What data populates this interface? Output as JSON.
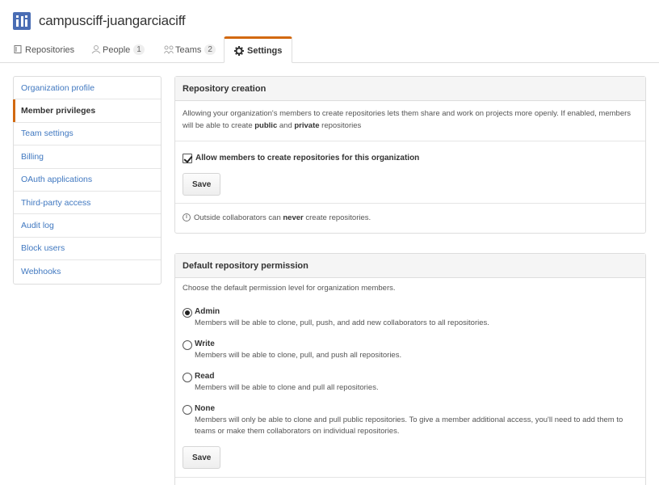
{
  "org": {
    "name": "campusciff-juangarciaciff"
  },
  "tabs": [
    {
      "label": "Repositories",
      "icon": "repo-icon"
    },
    {
      "label": "People",
      "count": "1",
      "icon": "people-icon"
    },
    {
      "label": "Teams",
      "count": "2",
      "icon": "teams-icon"
    },
    {
      "label": "Settings",
      "icon": "gear-icon"
    }
  ],
  "sidebar": {
    "items": [
      {
        "label": "Organization profile"
      },
      {
        "label": "Member privileges"
      },
      {
        "label": "Team settings"
      },
      {
        "label": "Billing"
      },
      {
        "label": "OAuth applications"
      },
      {
        "label": "Third-party access"
      },
      {
        "label": "Audit log"
      },
      {
        "label": "Block users"
      },
      {
        "label": "Webhooks"
      }
    ]
  },
  "repo_creation": {
    "title": "Repository creation",
    "desc_part1": "Allowing your organization's members to create repositories lets them share and work on projects more openly. If enabled, members will be able to create ",
    "desc_public": "public",
    "desc_and": " and ",
    "desc_private": "private",
    "desc_end": " repositories",
    "checkbox_label": "Allow members to create repositories for this organization",
    "save_label": "Save",
    "note_prefix": "Outside collaborators can ",
    "note_bold": "never",
    "note_suffix": " create repositories."
  },
  "default_permission": {
    "title": "Default repository permission",
    "intro": "Choose the default permission level for organization members.",
    "options": [
      {
        "label": "Admin",
        "desc": "Members will be able to clone, pull, push, and add new collaborators to all repositories."
      },
      {
        "label": "Write",
        "desc": "Members will be able to clone, pull, and push all repositories."
      },
      {
        "label": "Read",
        "desc": "Members will be able to clone and pull all repositories."
      },
      {
        "label": "None",
        "desc": "Members will only be able to clone and pull public repositories. To give a member additional access, you'll need to add them to teams or make them collaborators on individual repositories."
      }
    ],
    "selected": "Admin",
    "save_label": "Save"
  },
  "colors": {
    "accent": "#d26911",
    "link": "#4078c0",
    "avatar": "#4a6db4"
  }
}
